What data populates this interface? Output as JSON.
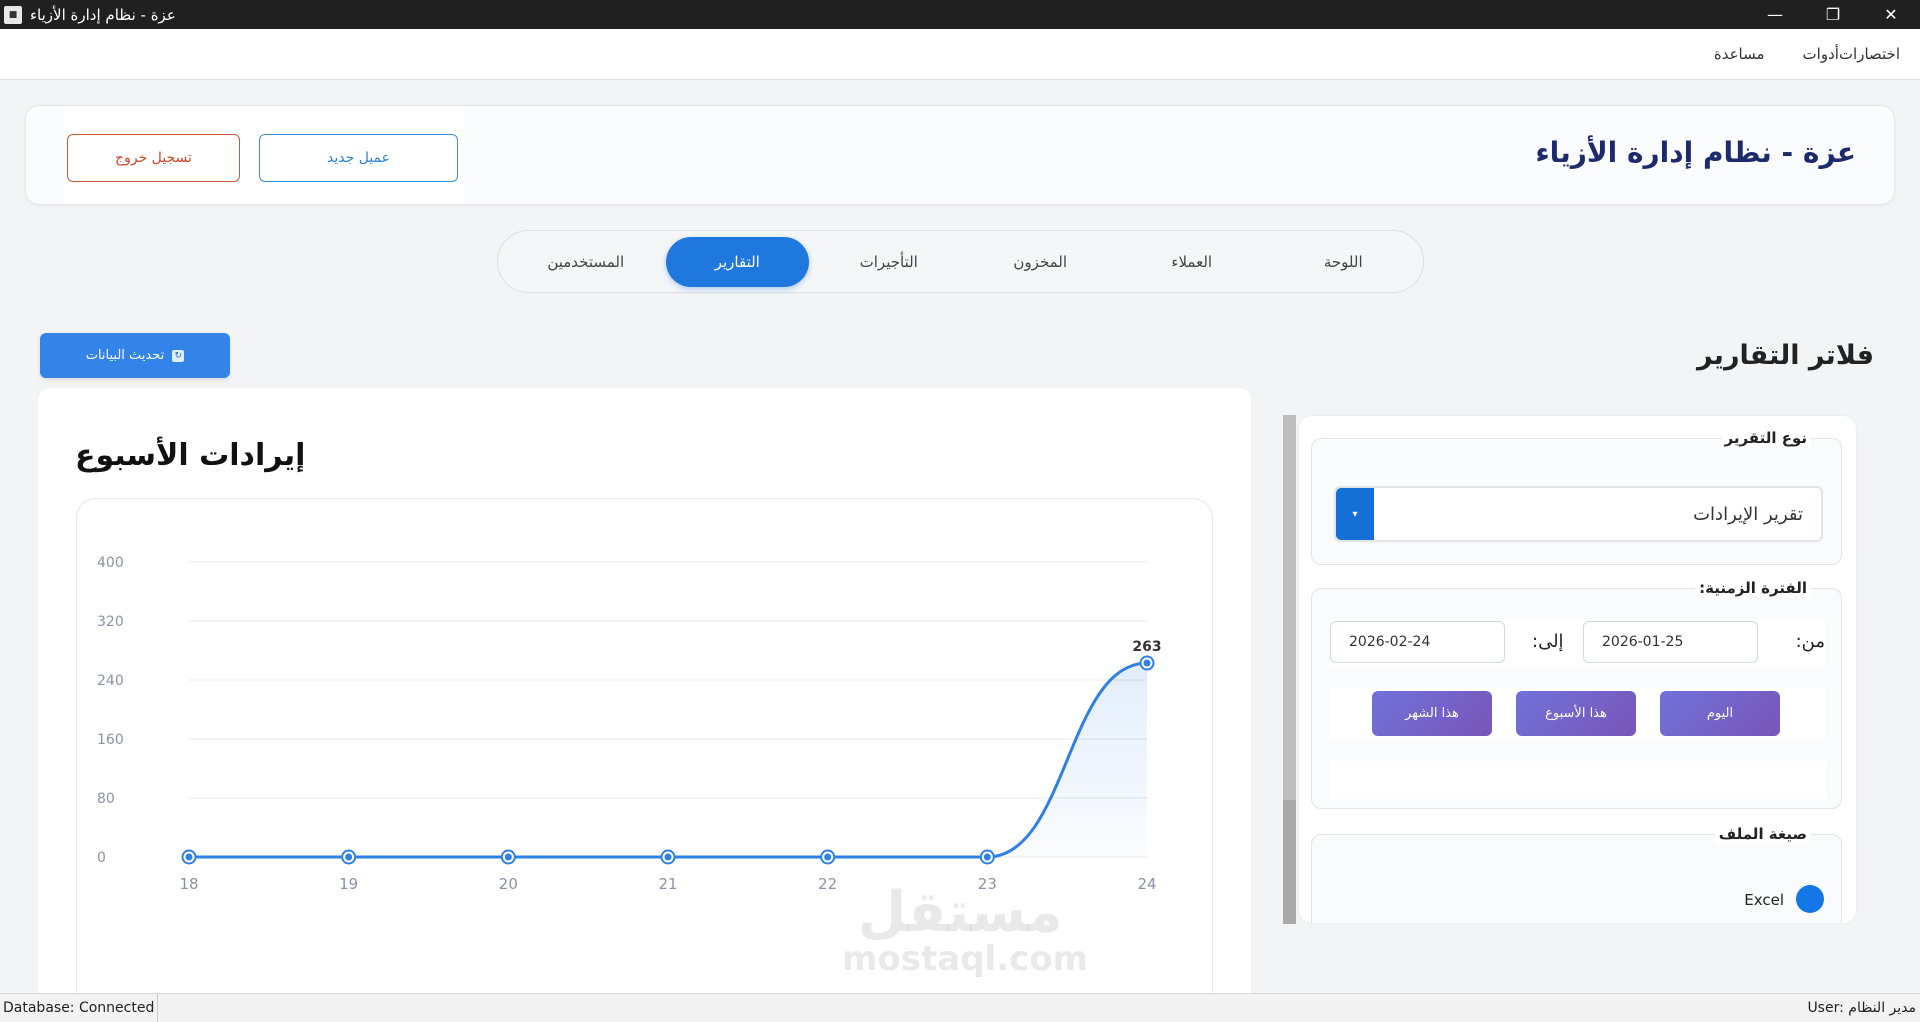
{
  "window": {
    "title": "عزة - نظام إدارة الأزياء",
    "app_icon": "app-icon",
    "controls": [
      "minimize-icon",
      "restore-icon",
      "close-icon"
    ]
  },
  "menubar": {
    "items": [
      "اختصارات",
      "أدوات",
      "مساعدة"
    ]
  },
  "header": {
    "title": "عزة - نظام إدارة الأزياء",
    "new_client_label": "عميل جديد",
    "logout_label": "تسجيل خروج"
  },
  "tabs": [
    {
      "label": "اللوحة",
      "active": false
    },
    {
      "label": "العملاء",
      "active": false
    },
    {
      "label": "المخزون",
      "active": false
    },
    {
      "label": "التأجيرات",
      "active": false
    },
    {
      "label": "التقارير",
      "active": true
    },
    {
      "label": "المستخدمين",
      "active": false
    }
  ],
  "refresh": {
    "label": "تحديث البيانات",
    "icon": "refresh-icon"
  },
  "filters": {
    "title": "فلاتر التقارير",
    "report_type": {
      "label": "نوع التقرير",
      "value": "تقرير الإيرادات"
    },
    "period": {
      "label": "الفترة الزمنية:",
      "from_label": "من:",
      "from_value": "2026-01-25",
      "to_label": "إلى:",
      "to_value": "2026-02-24",
      "quick": [
        "اليوم",
        "هذا الأسبوع",
        "هذا الشهر"
      ]
    },
    "format": {
      "label": "صيغة الملف",
      "option": "Excel"
    }
  },
  "chart_title": "إيرادات الأسبوع",
  "chart_data": {
    "type": "line",
    "x": [
      18,
      19,
      20,
      21,
      22,
      23,
      24
    ],
    "values": [
      0,
      0,
      0,
      0,
      0,
      0,
      263
    ],
    "data_labels": {
      "6": "263"
    },
    "yticks": [
      0,
      80,
      160,
      240,
      320,
      400
    ],
    "ylim": [
      0,
      400
    ],
    "grid": true,
    "line_color": "#2f80e6"
  },
  "statusbar": {
    "database": "Database: Connected",
    "user": "User: مدير النظام"
  },
  "watermark": {
    "arabic": "مستقل",
    "latin": "mostaql.com"
  },
  "colors": {
    "primary": "#1e78dd",
    "header_title": "#1d2a6b",
    "logout": "#c9482a",
    "quick_buttons": "#7560c6"
  }
}
